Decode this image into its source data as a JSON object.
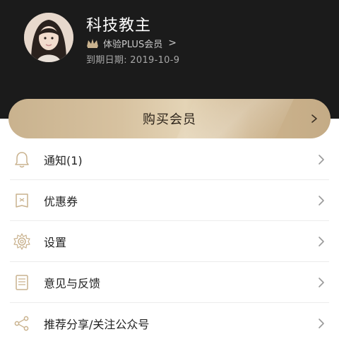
{
  "profile": {
    "name": "科技教主",
    "membership_label": "体验PLUS会员",
    "membership_chevron": ">",
    "expire_text": "到期日期: 2019-10-9"
  },
  "buy": {
    "label": "购买会员"
  },
  "menu": {
    "items": [
      {
        "label": "通知(1)",
        "icon": "bell-icon"
      },
      {
        "label": "优惠券",
        "icon": "coupon-icon"
      },
      {
        "label": "设置",
        "icon": "gear-icon"
      },
      {
        "label": "意见与反馈",
        "icon": "feedback-document-icon"
      },
      {
        "label": "推荐分享/关注公众号",
        "icon": "share-icon"
      }
    ]
  },
  "colors": {
    "header_bg": "#1b1b1b",
    "gold": "#d7c2a0",
    "icon_gold": "#c9b28e"
  }
}
